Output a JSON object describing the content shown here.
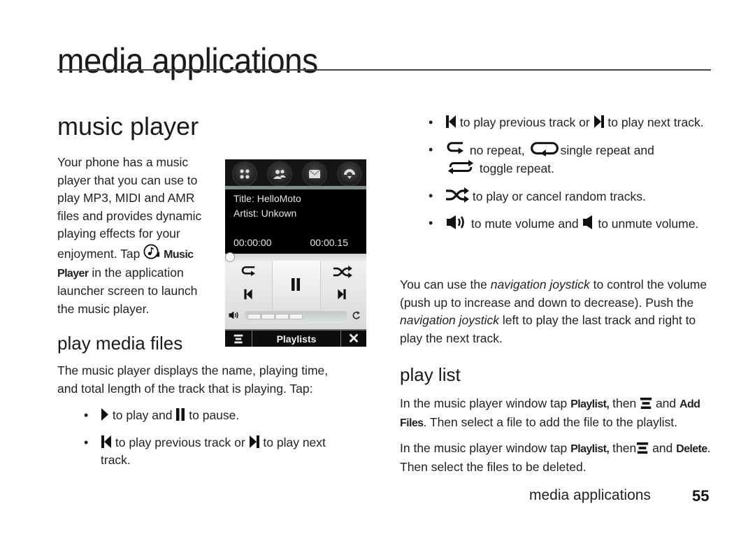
{
  "page": {
    "title": "media applications",
    "footer_label": "media applications",
    "page_number": "55"
  },
  "music_player": {
    "heading": "music player",
    "intro_before": "Your phone has a music player that you can use to play MP3, MIDI and AMR files and provides dynamic playing effects for your enjoyment. Tap",
    "intro_bold": "Music Player",
    "intro_after": "in the application launcher screen to launch the music player.",
    "intro_icon": "music-player-app-icon"
  },
  "phone_screen": {
    "top_icons": [
      "apps-grid-icon",
      "contacts-icon",
      "message-envelope-icon",
      "dialer-phone-icon"
    ],
    "title_line": "Title: HelloMoto",
    "artist_line": "Artist: Unkown",
    "elapsed_time": "00:00:00",
    "total_time": "00:00.15",
    "progress_fraction": 0.0,
    "volume_fraction": 0.55,
    "volume_segments_filled": 4,
    "bottom_bar": {
      "menu_icon": "menu-lines-icon",
      "label": "Playlists",
      "close_icon": "close-x-icon"
    }
  },
  "play_media_files": {
    "heading": "play media files",
    "intro": "The music player displays the name, playing time, and total length of the track that is playing. Tap:",
    "bullets": [
      {
        "icon1": "play-icon",
        "text1": "to play and",
        "icon2": "pause-icon",
        "text2": "to pause."
      },
      {
        "icon1": "previous-track-icon",
        "text1": "to play previous track or",
        "icon2": "next-track-icon",
        "text2": "to play next track."
      }
    ]
  },
  "right_bullets": [
    {
      "icon1": "previous-track-icon",
      "text1": "to play previous track or",
      "icon2": "next-track-icon",
      "text2": "to play next track."
    },
    {
      "icon1": "no-repeat-icon",
      "text1": "no repeat,",
      "icon2": "single-repeat-icon",
      "text2": "single repeat and",
      "icon3": "toggle-repeat-icon",
      "text3": "toggle repeat."
    },
    {
      "icon1": "shuffle-icon",
      "text1": "to play or cancel random tracks."
    },
    {
      "icon1": "volume-on-icon",
      "text1": "to mute volume and",
      "icon2": "volume-muted-icon",
      "text2": "to unmute volume."
    }
  ],
  "joystick_paragraph": {
    "p1": "You can use the",
    "em1": "navigation joystick",
    "p2": "to control the volume (push up to increase and down to decrease). Push the",
    "em2": "navigation joystick",
    "p3": "left to play the last track and right to play the next track."
  },
  "play_list": {
    "heading": "play list",
    "para1": {
      "a": "In the music player window tap",
      "b1": "Playlist,",
      "c": "then",
      "icon": "menu-lines-icon",
      "d": "and",
      "b2": "Add Files",
      "e": ". Then select a file to add the file to the playlist."
    },
    "para2": {
      "a": "In the music player window tap",
      "b1": "Playlist,",
      "c": "then",
      "icon": "menu-lines-icon",
      "d": "and",
      "b2": "Delete",
      "e": ". Then select the files to be deleted."
    }
  }
}
